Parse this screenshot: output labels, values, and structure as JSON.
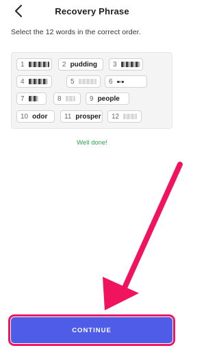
{
  "header": {
    "title": "Recovery Phrase",
    "back_icon": "chevron-left-icon"
  },
  "instruction": "Select the 12 words in the correct order.",
  "words": [
    {
      "num": "1",
      "word": "",
      "hidden": true
    },
    {
      "num": "2",
      "word": "pudding",
      "hidden": false
    },
    {
      "num": "3",
      "word": "",
      "hidden": true
    },
    {
      "num": "4",
      "word": "",
      "hidden": true
    },
    {
      "num": "5",
      "word": "",
      "hidden": true
    },
    {
      "num": "6",
      "word": "",
      "hidden": true
    },
    {
      "num": "7",
      "word": "",
      "hidden": true
    },
    {
      "num": "8",
      "word": "",
      "hidden": true
    },
    {
      "num": "9",
      "word": "people",
      "hidden": false
    },
    {
      "num": "10",
      "word": "odor",
      "hidden": false
    },
    {
      "num": "11",
      "word": "prosper",
      "hidden": false
    },
    {
      "num": "12",
      "word": "",
      "hidden": true
    }
  ],
  "status": {
    "text": "Well done!",
    "color": "#2fa84f"
  },
  "continue_button": {
    "label": "CONTINUE",
    "color": "#4f5ce8"
  },
  "annotation": {
    "arrow_color": "#f0145f",
    "highlight_color": "#f0145f"
  }
}
